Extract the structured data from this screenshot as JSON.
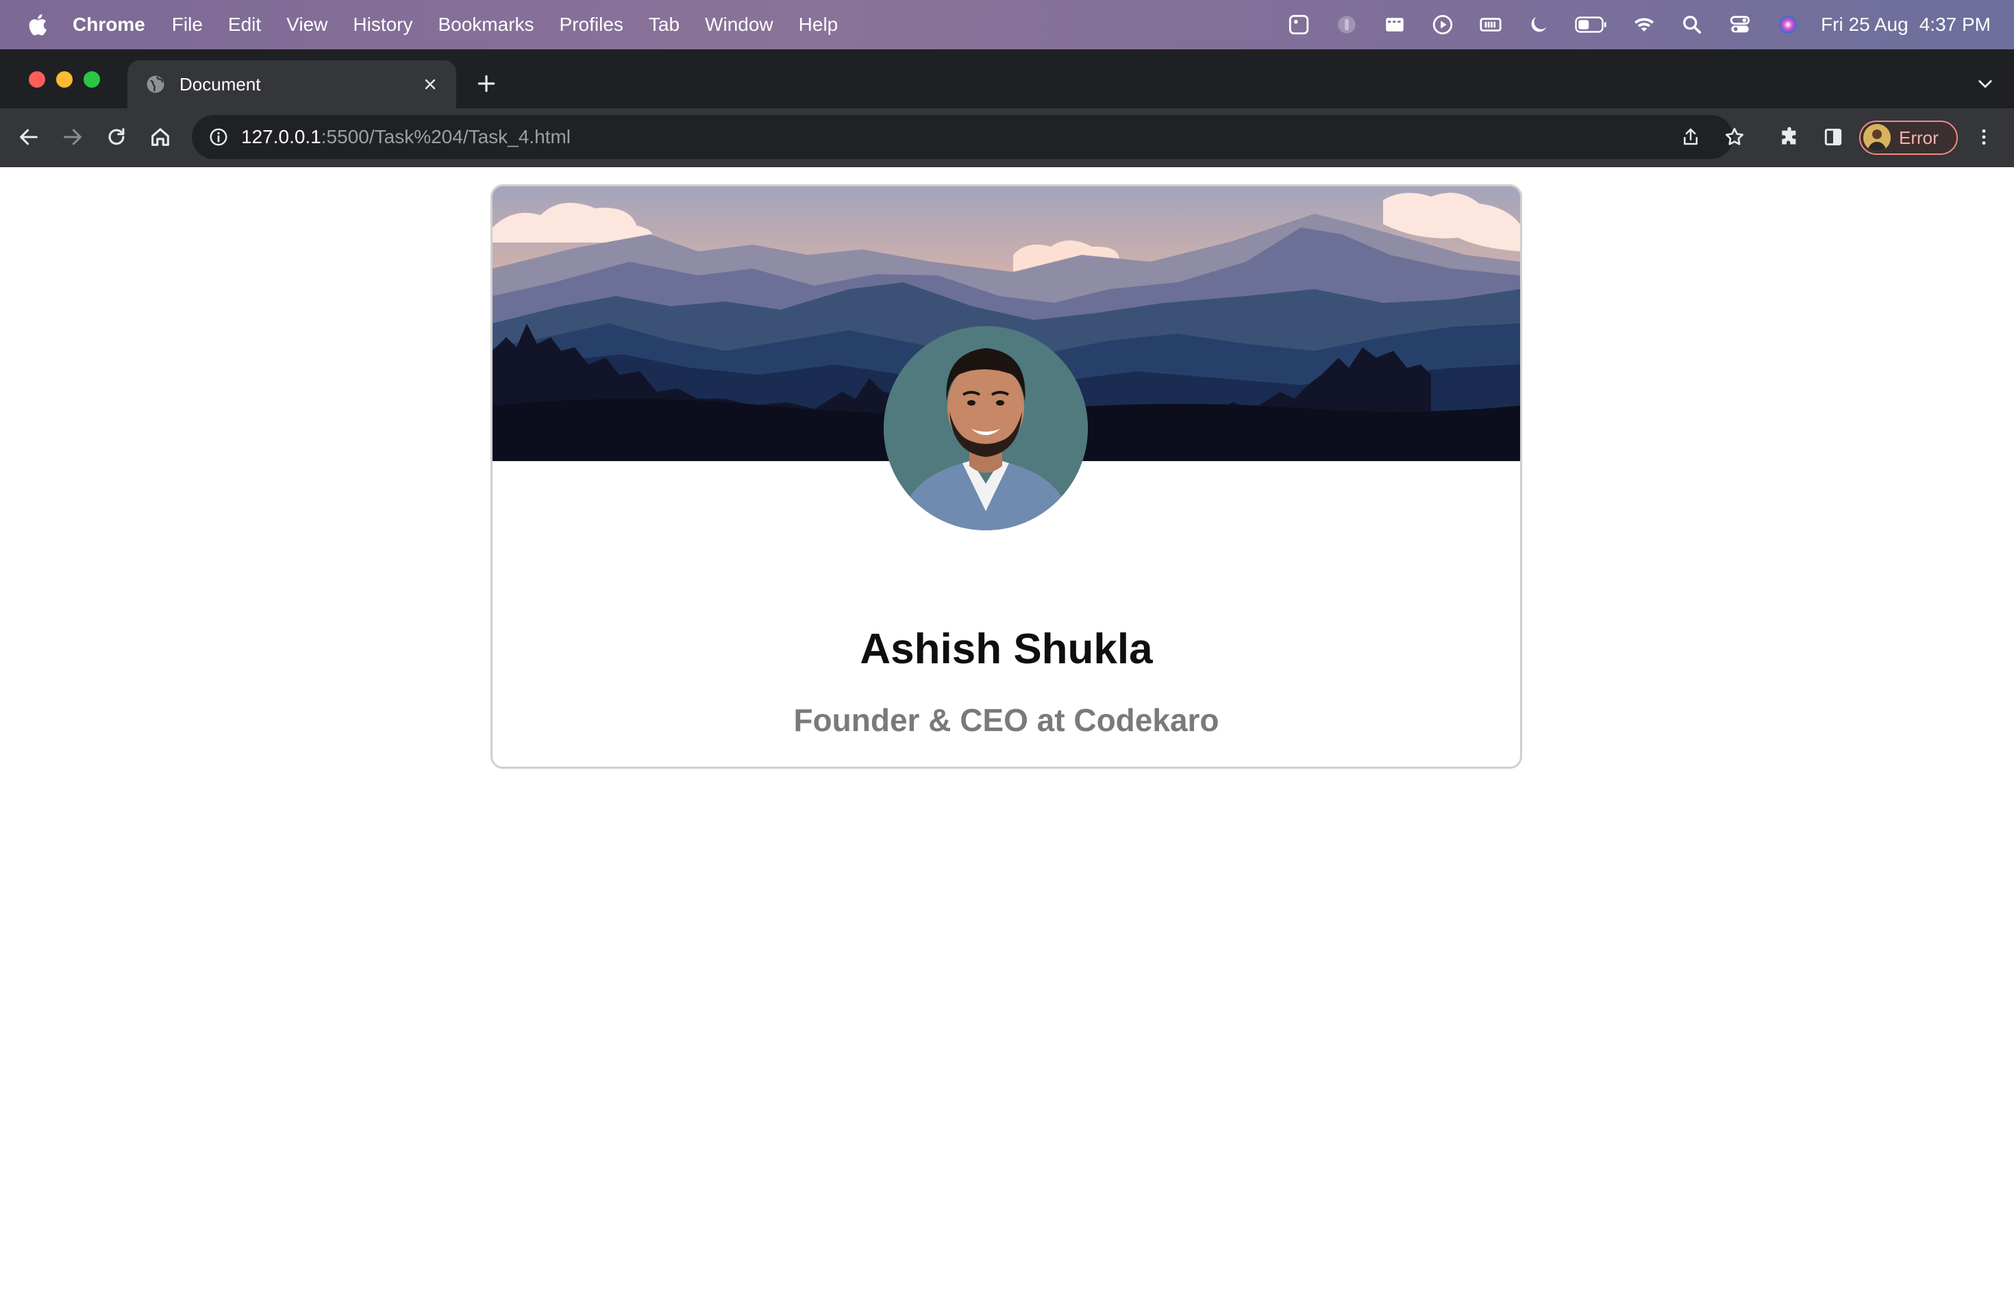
{
  "menubar": {
    "app_name": "Chrome",
    "items": [
      "File",
      "Edit",
      "View",
      "History",
      "Bookmarks",
      "Profiles",
      "Tab",
      "Window",
      "Help"
    ],
    "date": "Fri 25 Aug",
    "time": "4:37 PM"
  },
  "browser": {
    "tab_title": "Document",
    "url_host": "127.0.0.1",
    "url_rest": ":5500/Task%204/Task_4.html",
    "profile_label": "Error"
  },
  "profile_card": {
    "name": "Ashish Shukla",
    "role": "Founder & CEO at Codekaro"
  },
  "colors": {
    "card_border": "#cfcfcf",
    "name_color": "#0f0f0f",
    "role_color": "#7a7a7a",
    "error_accent": "#f28b82"
  }
}
